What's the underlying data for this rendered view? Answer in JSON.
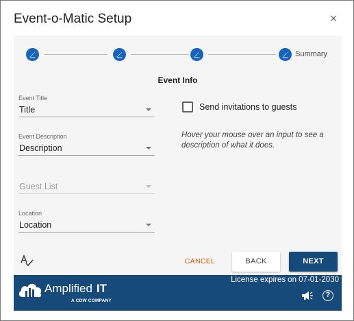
{
  "dialog": {
    "title": "Event-o-Matic Setup",
    "close_glyph": "×"
  },
  "stepper": {
    "steps": [
      {
        "icon": "pencil-icon"
      },
      {
        "icon": "pencil-icon"
      },
      {
        "icon": "pencil-icon"
      },
      {
        "icon": "pencil-icon",
        "label": "Summary"
      }
    ],
    "accent": "#1565c0"
  },
  "form": {
    "section_title": "Event Info",
    "fields": [
      {
        "label": "Event Title",
        "value": "Title"
      },
      {
        "label": "Event Description",
        "value": "Description"
      },
      {
        "label": "",
        "value": "Guest List",
        "disabled": true
      },
      {
        "label": "Location",
        "value": "Location"
      }
    ],
    "checkbox_label": "Send invitations to guests",
    "checkbox_checked": false,
    "hint": "Hover your mouse over an input to see a description of what it does."
  },
  "actions": {
    "cancel": "CANCEL",
    "back": "BACK",
    "next": "NEXT",
    "cancel_color": "#e65100",
    "next_color": "#164a7a"
  },
  "footer": {
    "brand_main": "Amplified",
    "brand_bold": "IT",
    "brand_sub": "A CDW COMPANY",
    "license": "License expires on 07-01-2030",
    "help_glyph": "?",
    "background": "#164a7a"
  }
}
